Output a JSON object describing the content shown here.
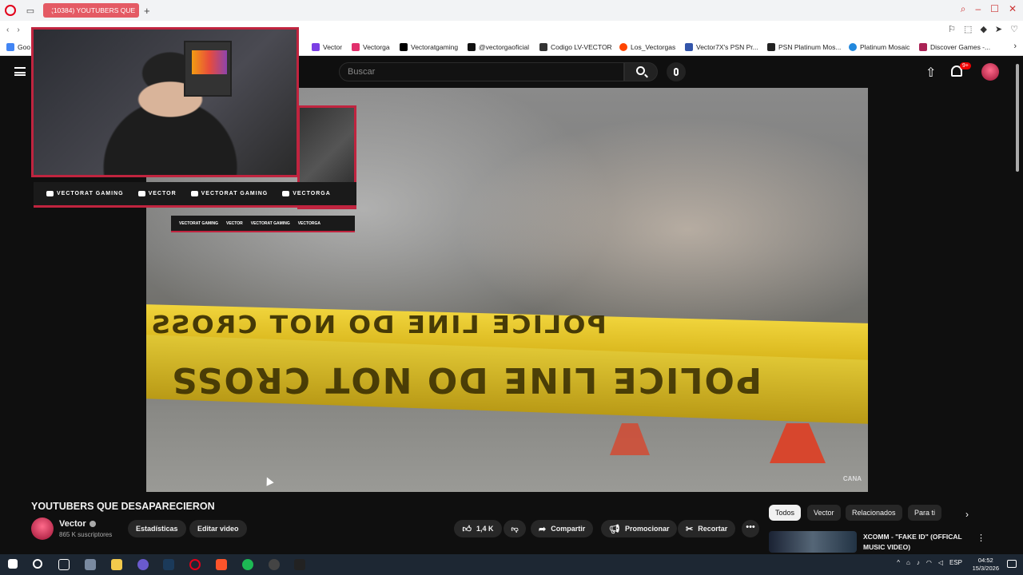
{
  "browser": {
    "tab_title": "(10384) YOUTUBERS QUE",
    "bookmarks": [
      {
        "label": "Goo",
        "color": "#4285f4"
      },
      {
        "label": "Vector",
        "color": "#7b3fe4"
      },
      {
        "label": "Vectorga",
        "color": "#e1306c"
      },
      {
        "label": "Vectoratgaming",
        "color": "#000000"
      },
      {
        "label": "@vectorgaoficial",
        "color": "#111111"
      },
      {
        "label": "Codigo LV-VECTOR",
        "color": "#333333"
      },
      {
        "label": "Los_Vectorgas",
        "color": "#ff4500"
      },
      {
        "label": "Vector7X's PSN Pr...",
        "color": "#3355aa"
      },
      {
        "label": "PSN Platinum Mos...",
        "color": "#222222"
      },
      {
        "label": "Platinum Mosaic",
        "color": "#2288dd"
      },
      {
        "label": "Discover Games -...",
        "color": "#aa2255"
      }
    ]
  },
  "youtube": {
    "search_placeholder": "Buscar",
    "notif_count": "9+",
    "video": {
      "title": "YOUTUBERS QUE DESAPARECIERON",
      "watermark": "CANA",
      "tape_text": "POLICE LINE DO NOT CROSS"
    },
    "channel": {
      "name": "Vector",
      "subs": "865 K suscriptores"
    },
    "actions": {
      "stats": "Estadísticas",
      "edit": "Editar video",
      "likes": "1,4 K",
      "share": "Compartir",
      "promote": "Promocionar",
      "clip": "Recortar"
    },
    "chips": [
      "Todos",
      "Vector",
      "Relacionados",
      "Para ti"
    ],
    "related": {
      "title": "XCOMM - \"FAKE ID\" (OFFICAL MUSIC VIDEO)"
    }
  },
  "overlay": {
    "socials": [
      "VECTORAT GAMING",
      "VECTOR",
      "VECTORAT GAMING",
      "VECTORGA"
    ]
  },
  "taskbar": {
    "lang": "ESP",
    "time": "04:52",
    "date": "15/3/2026"
  }
}
